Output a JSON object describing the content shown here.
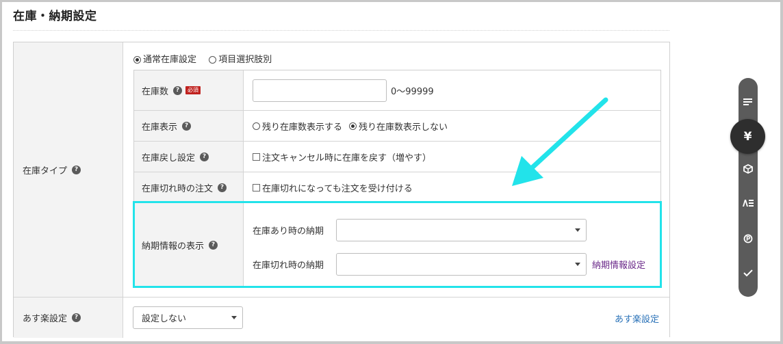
{
  "page_title": "在庫・納期設定",
  "stock_type": {
    "label": "在庫タイプ",
    "options": [
      {
        "label": "通常在庫設定",
        "selected": true
      },
      {
        "label": "項目選択肢別",
        "selected": false
      }
    ]
  },
  "rows": {
    "stock_count": {
      "label": "在庫数",
      "required_badge": "必須",
      "value": "",
      "range": "0〜99999"
    },
    "stock_display": {
      "label": "在庫表示",
      "options": [
        {
          "label": "残り在庫数表示する",
          "selected": false
        },
        {
          "label": "残り在庫数表示しない",
          "selected": true
        }
      ]
    },
    "stock_return": {
      "label": "在庫戻し設定",
      "checkbox_label": "注文キャンセル時に在庫を戻す（増やす）",
      "checked": false
    },
    "out_of_stock_order": {
      "label": "在庫切れ時の注文",
      "checkbox_label": "在庫切れになっても注文を受け付ける",
      "checked": false
    },
    "delivery_info": {
      "label": "納期情報の表示",
      "in_stock_label": "在庫あり時の納期",
      "in_stock_value": "",
      "out_of_stock_label": "在庫切れ時の納期",
      "out_of_stock_value": "",
      "settings_link": "納期情報設定"
    }
  },
  "asuraku": {
    "label": "あす楽設定",
    "select_value": "設定しない",
    "settings_link": "あす楽設定"
  },
  "help_glyph": "?",
  "rail": {
    "icons": [
      "lines-icon",
      "yen-icon",
      "box-icon",
      "text-format-icon",
      "points-icon",
      "check-icon"
    ],
    "active_glyph": "¥"
  },
  "colors": {
    "highlight": "#22e3ea",
    "arrow": "#22e3ea",
    "required": "#c0221f",
    "link": "#2a72b8"
  }
}
